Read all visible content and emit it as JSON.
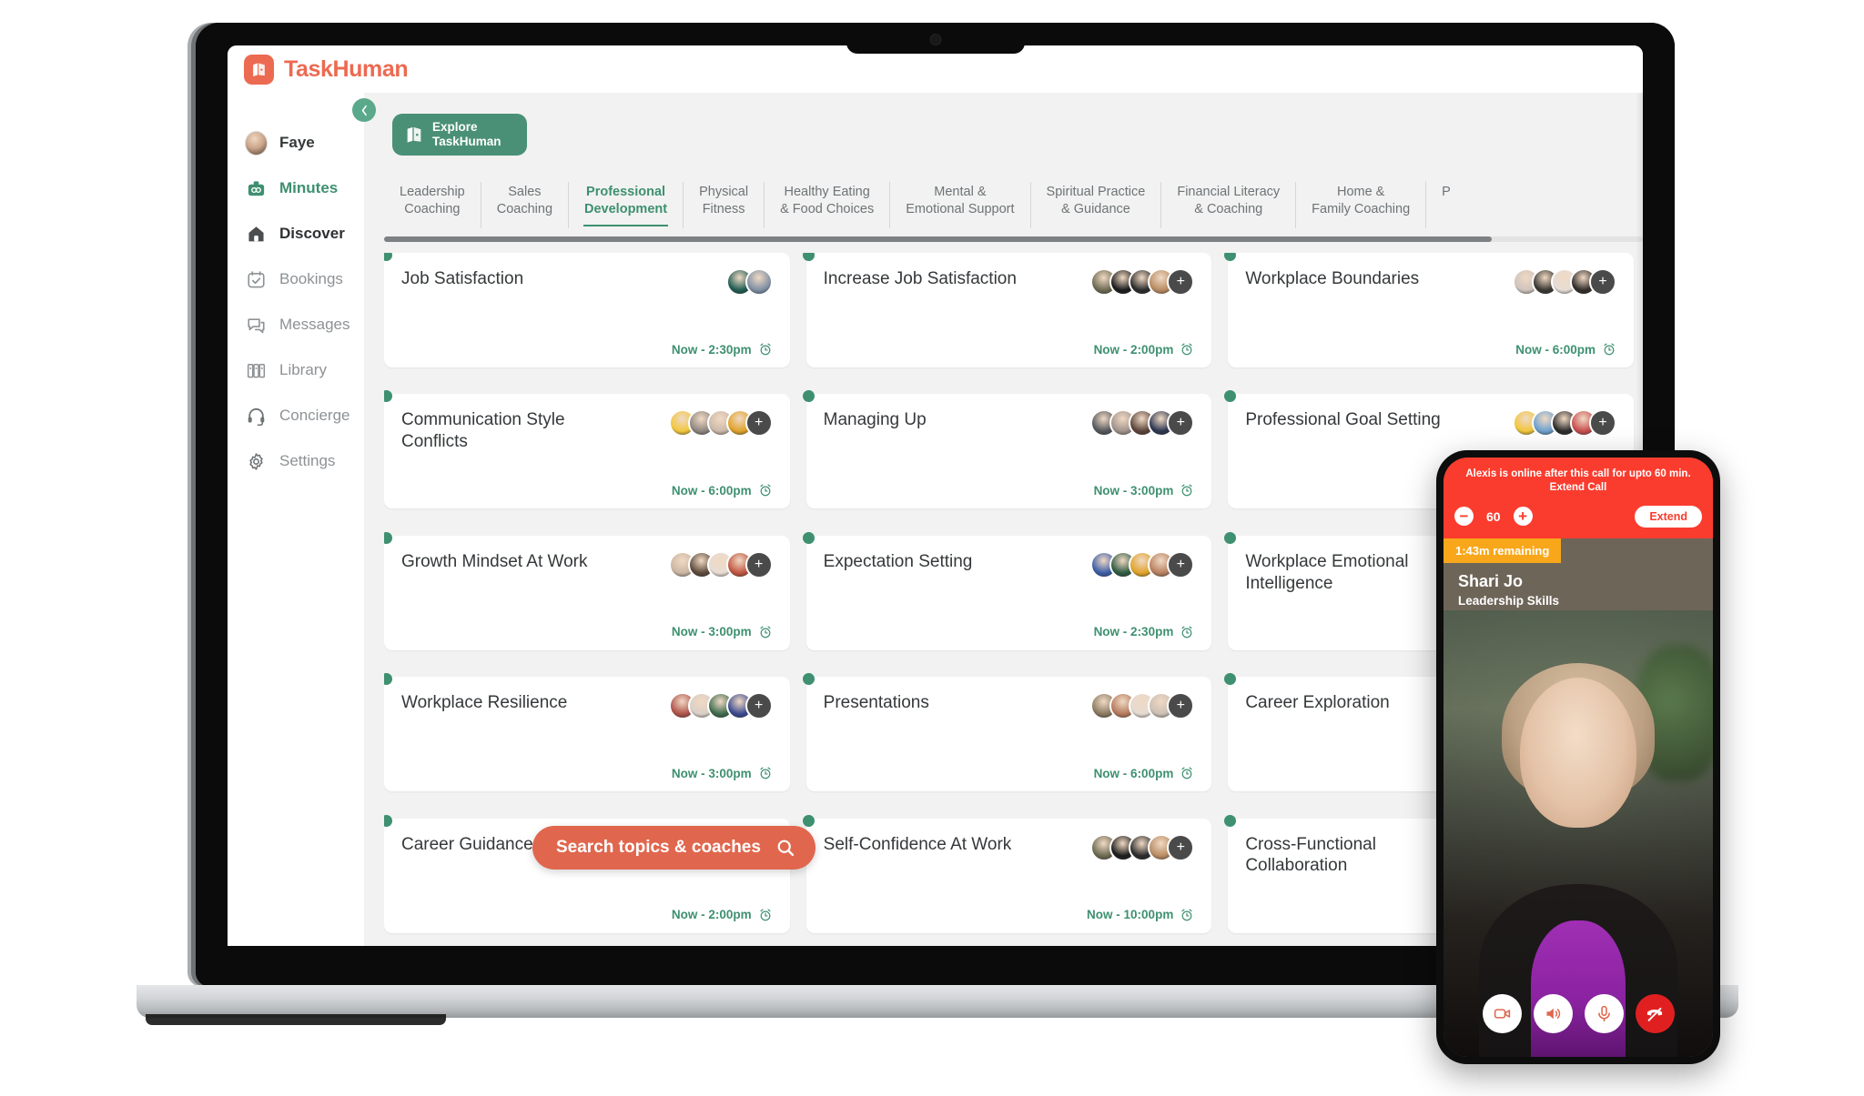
{
  "brand": {
    "name": "TaskHuman",
    "logo_icon": "taskhuman-logo-icon"
  },
  "sidebar": {
    "collapse_icon": "chevron-left-icon",
    "items": [
      {
        "label": "Faye",
        "icon": "user-avatar",
        "state": "user"
      },
      {
        "label": "Minutes",
        "icon": "minutes-icon",
        "state": "active-green"
      },
      {
        "label": "Discover",
        "icon": "home-icon",
        "state": "active-dark"
      },
      {
        "label": "Bookings",
        "icon": "calendar-check-icon",
        "state": ""
      },
      {
        "label": "Messages",
        "icon": "chat-bubbles-icon",
        "state": ""
      },
      {
        "label": "Library",
        "icon": "library-books-icon",
        "state": ""
      },
      {
        "label": "Concierge",
        "icon": "headset-icon",
        "state": ""
      },
      {
        "label": "Settings",
        "icon": "gear-icon",
        "state": ""
      }
    ]
  },
  "explore_button": {
    "line1": "Explore",
    "line2": "TaskHuman",
    "icon": "taskhuman-logo-icon"
  },
  "tabs": [
    {
      "label": "Leadership\nCoaching",
      "active": false
    },
    {
      "label": "Sales\nCoaching",
      "active": false
    },
    {
      "label": "Professional\nDevelopment",
      "active": true
    },
    {
      "label": "Physical\nFitness",
      "active": false
    },
    {
      "label": "Healthy Eating\n& Food Choices",
      "active": false
    },
    {
      "label": "Mental &\nEmotional Support",
      "active": false
    },
    {
      "label": "Spiritual Practice\n& Guidance",
      "active": false
    },
    {
      "label": "Financial Literacy\n& Coaching",
      "active": false
    },
    {
      "label": "Home &\nFamily Coaching",
      "active": false
    },
    {
      "label": "P",
      "active": false
    }
  ],
  "cards": [
    {
      "title": "Job Satisfaction",
      "time": "Now - 2:30pm",
      "coaches": 2,
      "more": false
    },
    {
      "title": "Increase Job Satisfaction",
      "time": "Now - 2:00pm",
      "coaches": 4,
      "more": true
    },
    {
      "title": "Workplace Boundaries",
      "time": "Now - 6:00pm",
      "coaches": 4,
      "more": true
    },
    {
      "title": "Communication Style Conflicts",
      "time": "Now - 6:00pm",
      "coaches": 4,
      "more": true
    },
    {
      "title": "Managing Up",
      "time": "Now - 3:00pm",
      "coaches": 4,
      "more": true
    },
    {
      "title": "Professional Goal Setting",
      "time": "",
      "coaches": 4,
      "more": true
    },
    {
      "title": "Growth Mindset At Work",
      "time": "Now - 3:00pm",
      "coaches": 4,
      "more": true
    },
    {
      "title": "Expectation Setting",
      "time": "Now - 2:30pm",
      "coaches": 4,
      "more": true
    },
    {
      "title": "Workplace Emotional Intelligence",
      "time": "",
      "coaches": 0,
      "more": false
    },
    {
      "title": "Workplace Resilience",
      "time": "Now - 3:00pm",
      "coaches": 4,
      "more": true
    },
    {
      "title": "Presentations",
      "time": "Now - 6:00pm",
      "coaches": 4,
      "more": true
    },
    {
      "title": "Career Exploration",
      "time": "",
      "coaches": 0,
      "more": false
    },
    {
      "title": "Career Guidance",
      "time": "Now - 2:00pm",
      "coaches": 4,
      "more": true
    },
    {
      "title": "Self-Confidence At Work",
      "time": "Now - 10:00pm",
      "coaches": 4,
      "more": true
    },
    {
      "title": "Cross-Functional Collaboration",
      "time": "",
      "coaches": 0,
      "more": false
    }
  ],
  "search": {
    "label": "Search topics & coaches",
    "icon": "search-icon"
  },
  "phone_call": {
    "extend_message": "Alexis is online after this call for upto 60 min. Extend Call",
    "minus_icon": "minus-circle-icon",
    "plus_icon": "plus-circle-icon",
    "minutes_value": "60",
    "extend_button": "Extend",
    "remaining": "1:43m remaining",
    "coach_name": "Shari Jo",
    "coach_topic": "Leadership Skills",
    "controls": [
      {
        "name": "video-icon"
      },
      {
        "name": "speaker-icon"
      },
      {
        "name": "microphone-icon"
      },
      {
        "name": "end-call-icon"
      }
    ]
  },
  "colors": {
    "brand_orange": "#ec6a51",
    "accent_green": "#3e9070",
    "explore_green": "#4a9077",
    "search_orange": "#e0674e",
    "alert_red": "#fa3c2e",
    "warning_amber": "#f8a71b",
    "end_call_red": "#e02020"
  },
  "coach_palettes": [
    [
      "#1f5c52",
      "#7e8fa3"
    ],
    [
      "#6d6a52",
      "#1b1b1b",
      "#2b2b2b",
      "#b98b62",
      "#4a4a4a"
    ],
    [
      "#cfc4bd",
      "#3a3732",
      "#e6ddd6",
      "#312c2a",
      "#4a4a4a"
    ],
    [
      "#f2c73d",
      "#8f8680",
      "#cbb9a8",
      "#e0a32a",
      "#4a4a4a"
    ],
    [
      "#54575c",
      "#a1938c",
      "#5a4439",
      "#2c3650",
      "#4a4a4a"
    ],
    [
      "#f2c73d",
      "#6ea2cf",
      "#2c2c2c",
      "#c94f4f",
      "#4a4a4a"
    ],
    [
      "#cbb6a3",
      "#5d4a3c",
      "#e8dcd2",
      "#c0553f",
      "#4a4a4a"
    ],
    [
      "#3a5da8",
      "#2f5a42",
      "#e0a32a",
      "#b8805e",
      "#4a4a4a"
    ],
    [
      "#b9453f",
      "#cfc2b8",
      "#2b3b2f",
      "#3d4a8c",
      "#4a4a4a"
    ],
    [
      "#b0534b",
      "#d9cfc6",
      "#3d6b4d",
      "#3a4a8f",
      "#4a4a4a"
    ],
    [
      "#8b7a60",
      "#b47a5c",
      "#e4dad1",
      "#cbbfb4",
      "#4a4a4a"
    ],
    [
      "#f2c73d",
      "#d05b4a",
      "#cfc4bd",
      "#7a5c47",
      "#4a4a4a"
    ]
  ]
}
